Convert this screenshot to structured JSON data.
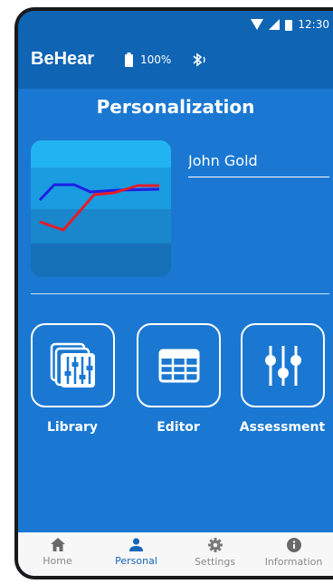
{
  "status_bar": {
    "time": "12:30"
  },
  "app_bar": {
    "brand": "BeHear",
    "battery": "100%"
  },
  "page": {
    "title": "Personalization"
  },
  "profile": {
    "name_value": "John Gold"
  },
  "tiles": [
    {
      "label": "Library",
      "icon": "library-icon"
    },
    {
      "label": "Editor",
      "icon": "grid-icon"
    },
    {
      "label": "Assessment",
      "icon": "sliders-icon"
    }
  ],
  "bottom_nav": [
    {
      "label": "Home",
      "icon": "home-icon",
      "active": false
    },
    {
      "label": "Personal",
      "icon": "person-icon",
      "active": true
    },
    {
      "label": "Settings",
      "icon": "gear-icon",
      "active": false
    },
    {
      "label": "Information",
      "icon": "info-icon",
      "active": false
    }
  ],
  "colors": {
    "primary": "#1a78d2",
    "bar": "#0f64b4",
    "active": "#1466b8"
  }
}
